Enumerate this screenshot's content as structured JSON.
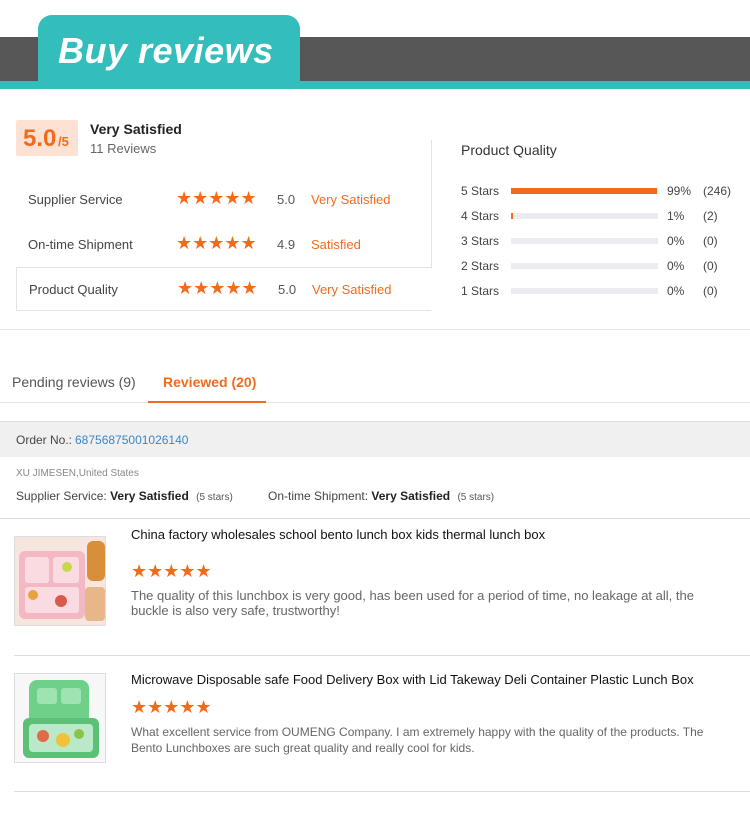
{
  "banner": {
    "title": "Buy reviews"
  },
  "summary": {
    "score": "5.0",
    "score_suffix": "/5",
    "rating_text": "Very Satisfied",
    "review_count": "11 Reviews",
    "metrics": [
      {
        "label": "Supplier Service",
        "score": "5.0",
        "text": "Very Satisfied",
        "stars": 5
      },
      {
        "label": "On-time Shipment",
        "score": "4.9",
        "text": "Satisfied",
        "stars": 5
      },
      {
        "label": "Product Quality",
        "score": "5.0",
        "text": "Very Satisfied",
        "stars": 5
      }
    ]
  },
  "quality": {
    "title": "Product Quality",
    "distribution": [
      {
        "label": "5 Stars",
        "percent": "99%",
        "count": "(246)",
        "fraction": 0.99
      },
      {
        "label": "4 Stars",
        "percent": "1%",
        "count": "(2)",
        "fraction": 0.01
      },
      {
        "label": "3 Stars",
        "percent": "0%",
        "count": "(0)",
        "fraction": 0
      },
      {
        "label": "2 Stars",
        "percent": "0%",
        "count": "(0)",
        "fraction": 0
      },
      {
        "label": "1 Stars",
        "percent": "0%",
        "count": "(0)",
        "fraction": 0
      }
    ]
  },
  "tabs": [
    {
      "label": "Pending reviews (9)",
      "active": false
    },
    {
      "label": "Reviewed (20)",
      "active": true
    }
  ],
  "order": {
    "label": "Order No.:",
    "number": "68756875001026140",
    "buyer": "XU JIMESEN,United States",
    "supplier_label": "Supplier Service:",
    "supplier_value": "Very Satisfied",
    "supplier_stars": "(5 stars)",
    "ontime_label": "On-time Shipment:",
    "ontime_value": "Very Satisfied",
    "ontime_stars": "(5 stars)"
  },
  "products": [
    {
      "title": "China factory wholesales school bento lunch box kids thermal lunch box",
      "stars": "★★★★★",
      "review": "The quality of this lunchbox is very good, has been used for a period of time, no leakage at all, the buckle is also very safe, trustworthy!",
      "image_color": "#f3b8c4"
    },
    {
      "title": "Microwave Disposable safe Food Delivery Box with Lid Takeway Deli Container Plastic Lunch Box",
      "stars": "★★★★★",
      "review": "What excellent service from OUMENG Company. I am extremely happy with the quality of the products. The Bento Lunchboxes are such great quality and really cool for kids.",
      "image_color": "#6fd08a"
    }
  ],
  "icons": {
    "star": "star-icon"
  },
  "colors": {
    "accent": "#f26b1d",
    "teal": "#33bdbb",
    "dark": "#575757",
    "link": "#3a86c8"
  }
}
